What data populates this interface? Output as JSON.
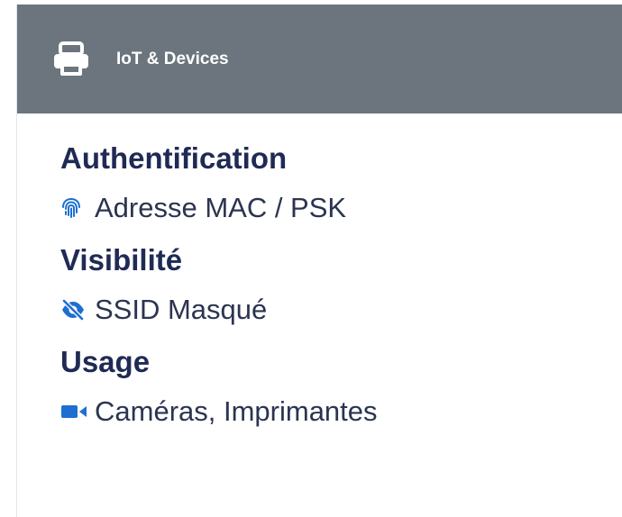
{
  "header": {
    "icon": "printer-icon",
    "title": "IoT & Devices"
  },
  "sections": [
    {
      "title": "Authentification",
      "icon": "fingerprint-icon",
      "value": "Adresse MAC / PSK"
    },
    {
      "title": "Visibilité",
      "icon": "eye-slash-icon",
      "value": "SSID Masqué"
    },
    {
      "title": "Usage",
      "icon": "video-camera-icon",
      "value": "Caméras, Imprimantes"
    }
  ],
  "colors": {
    "header_bg": "#6c757d",
    "title_text": "#1f2a55",
    "icon_accent": "#1e6fd0"
  }
}
